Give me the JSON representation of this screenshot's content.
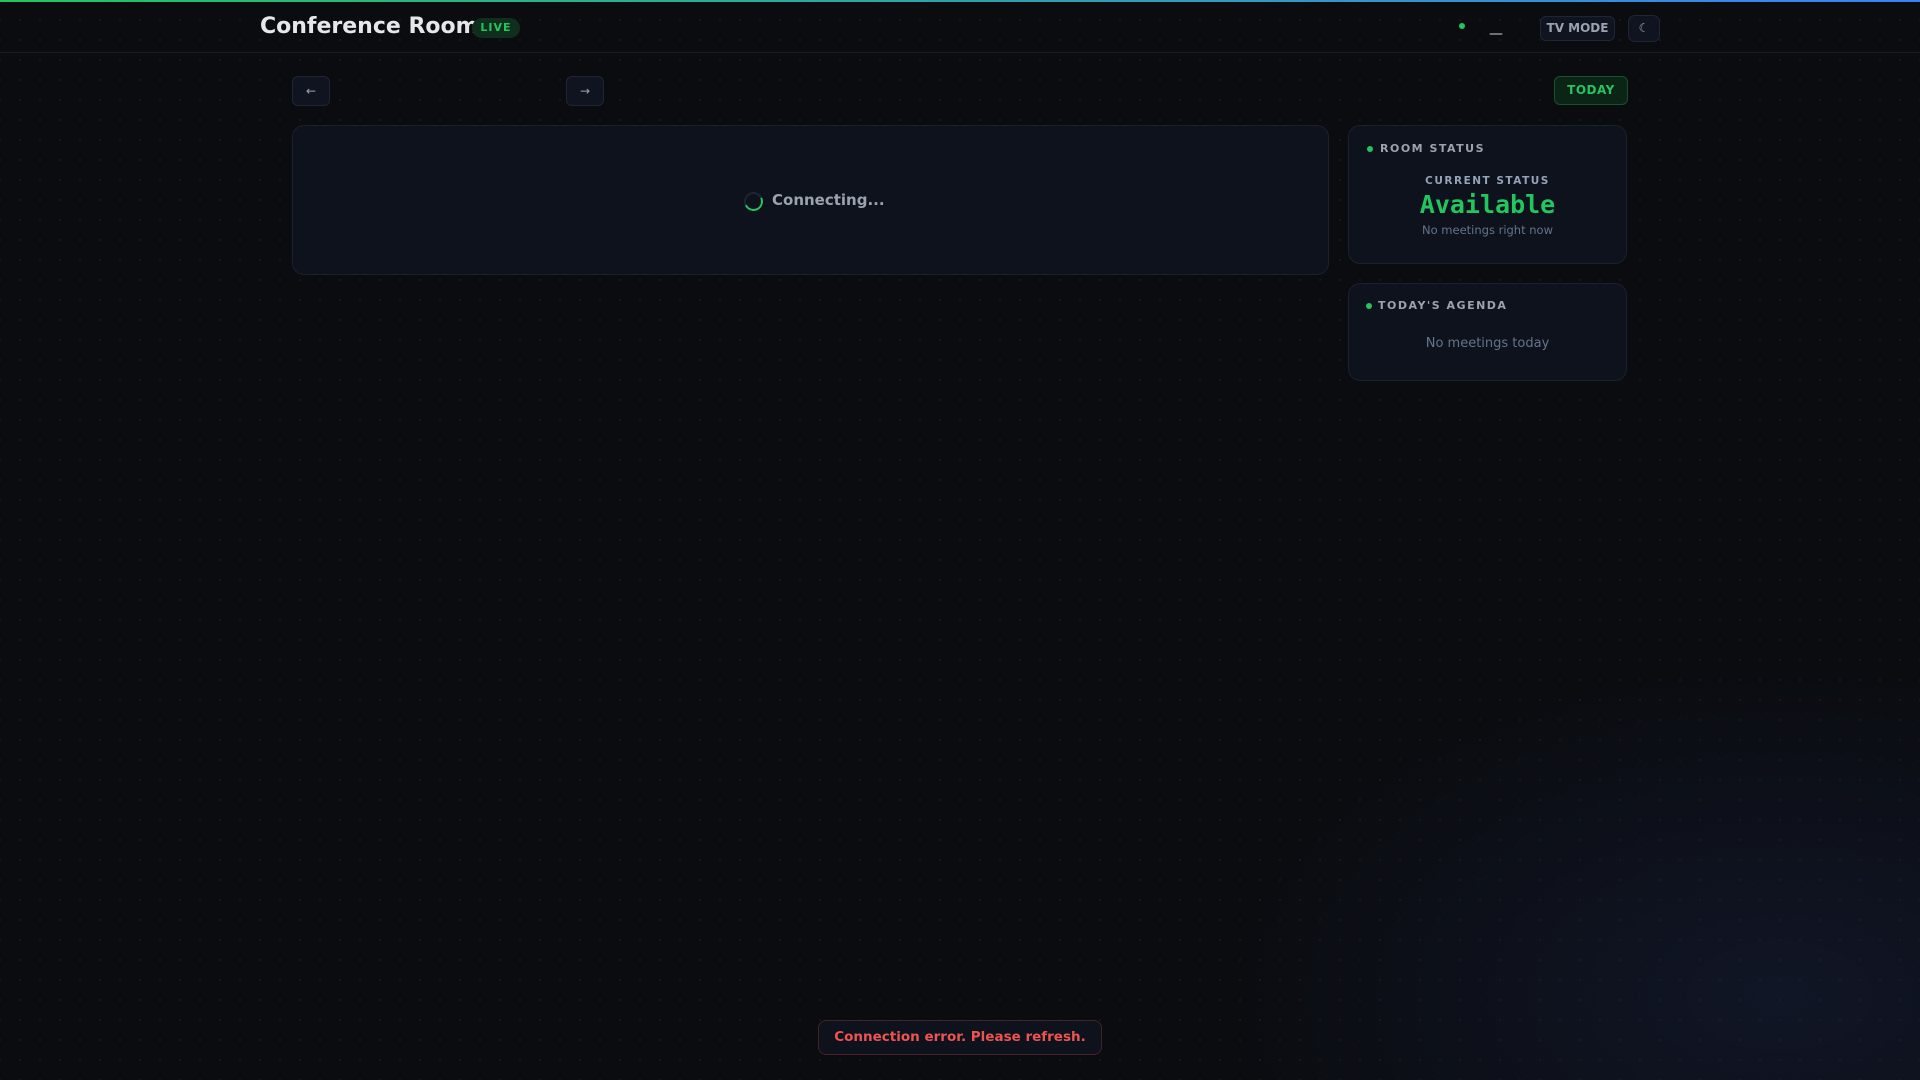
{
  "header": {
    "title": "Conference Room",
    "live_badge": "LIVE",
    "connection_indicator": "—",
    "tv_mode_label": "TV MODE",
    "theme_icon": "☾"
  },
  "nav": {
    "prev_label": "←",
    "next_label": "→",
    "today_label": "TODAY"
  },
  "main": {
    "loading_text": "Connecting..."
  },
  "room_status": {
    "title": "ROOM STATUS",
    "current_status_label": "CURRENT STATUS",
    "status": "Available",
    "subtext": "No meetings right now"
  },
  "agenda": {
    "title": "TODAY'S AGENDA",
    "empty_text": "No meetings today"
  },
  "toast": {
    "message": "Connection error. Please refresh."
  },
  "colors": {
    "accent": "#22c55e",
    "error": "#ef5350",
    "background": "#0a0c10"
  }
}
